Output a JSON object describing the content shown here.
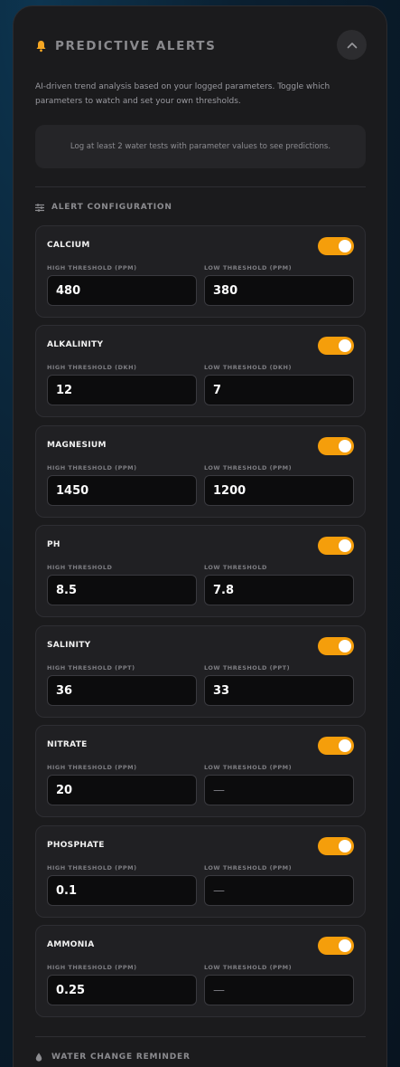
{
  "header": {
    "title": "PREDICTIVE ALERTS",
    "icon": "bell-icon",
    "accent": "#f59e0b"
  },
  "description": "AI-driven trend analysis based on your logged parameters. Toggle which parameters to watch and set your own thresholds.",
  "notice": "Log at least 2 water tests with parameter values to see predictions.",
  "alert_config": {
    "title": "ALERT CONFIGURATION",
    "icon": "sliders-icon",
    "parameters": [
      {
        "name": "CALCIUM",
        "enabled": true,
        "high_label": "HIGH THRESHOLD (PPM)",
        "low_label": "LOW THRESHOLD (PPM)",
        "high": "480",
        "low": "380"
      },
      {
        "name": "ALKALINITY",
        "enabled": true,
        "high_label": "HIGH THRESHOLD (DKH)",
        "low_label": "LOW THRESHOLD (DKH)",
        "high": "12",
        "low": "7"
      },
      {
        "name": "MAGNESIUM",
        "enabled": true,
        "high_label": "HIGH THRESHOLD (PPM)",
        "low_label": "LOW THRESHOLD (PPM)",
        "high": "1450",
        "low": "1200"
      },
      {
        "name": "PH",
        "enabled": true,
        "high_label": "HIGH THRESHOLD",
        "low_label": "LOW THRESHOLD",
        "high": "8.5",
        "low": "7.8"
      },
      {
        "name": "SALINITY",
        "enabled": true,
        "high_label": "HIGH THRESHOLD (PPT)",
        "low_label": "LOW THRESHOLD (PPT)",
        "high": "36",
        "low": "33"
      },
      {
        "name": "NITRATE",
        "enabled": true,
        "high_label": "HIGH THRESHOLD (PPM)",
        "low_label": "LOW THRESHOLD (PPM)",
        "high": "20",
        "low": "—"
      },
      {
        "name": "PHOSPHATE",
        "enabled": true,
        "high_label": "HIGH THRESHOLD (PPM)",
        "low_label": "LOW THRESHOLD (PPM)",
        "high": "0.1",
        "low": "—"
      },
      {
        "name": "AMMONIA",
        "enabled": true,
        "high_label": "HIGH THRESHOLD (PPM)",
        "low_label": "LOW THRESHOLD (PPM)",
        "high": "0.25",
        "low": "—"
      }
    ]
  },
  "water_change": {
    "title": "WATER CHANGE REMINDER",
    "icon": "droplet-icon"
  }
}
